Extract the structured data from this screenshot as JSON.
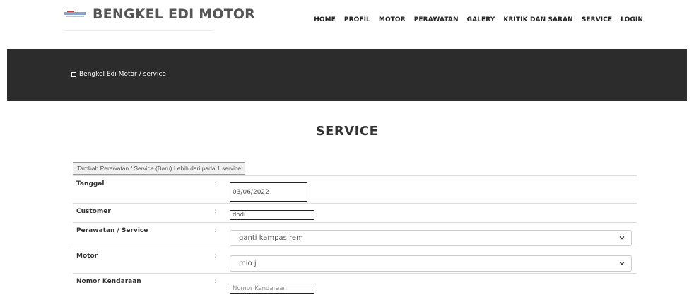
{
  "brand": {
    "title": "BENGKEL EDI MOTOR"
  },
  "nav": [
    "HOME",
    "PROFIL",
    "MOTOR",
    "PERAWATAN",
    "GALERY",
    "KRITIK DAN SARAN",
    "SERVICE",
    "LOGIN"
  ],
  "breadcrumb": {
    "home": "Bengkel Edi Motor",
    "separator": "/",
    "current": "service"
  },
  "section": {
    "title": "SERVICE"
  },
  "form": {
    "add_button": "Tambah Perawatan / Service (Baru) Lebih dari pada 1 service",
    "colon": ":",
    "fields": {
      "tanggal": {
        "label": "Tanggal",
        "value": "03/06/2022"
      },
      "customer": {
        "label": "Customer",
        "value": "dodi"
      },
      "perawatan": {
        "label": "Perawatan / Service",
        "value": "ganti kampas rem"
      },
      "motor": {
        "label": "Motor",
        "value": "mio j"
      },
      "nomor": {
        "label": "Nomor Kendaraan",
        "placeholder": "Nomor Kendaraan"
      }
    }
  },
  "colors": {
    "band": "#2c2c2c",
    "text": "#333333",
    "border": "#dddddd"
  }
}
